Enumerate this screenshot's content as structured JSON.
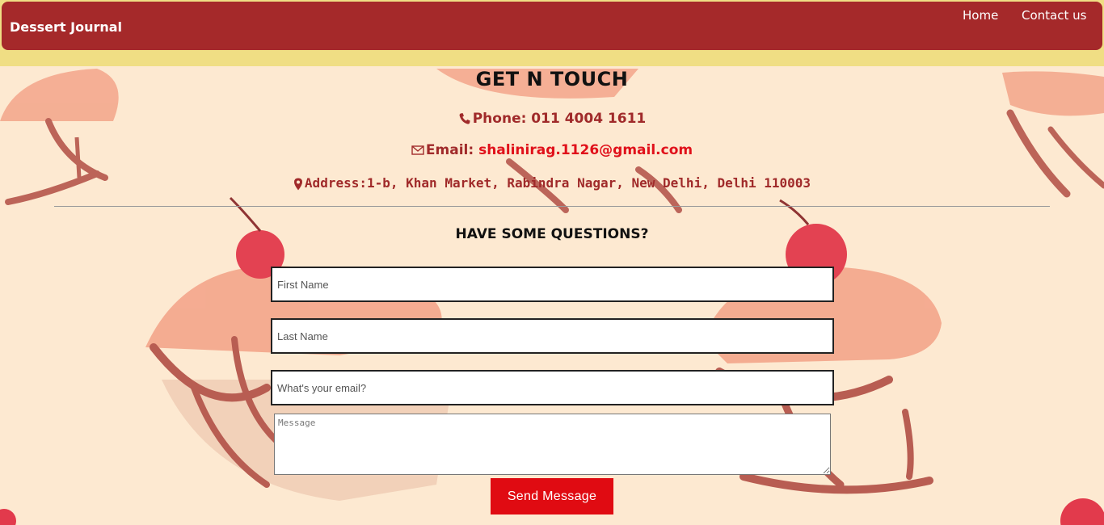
{
  "navbar": {
    "brand": "Dessert Journal",
    "links": [
      {
        "label": "Home"
      },
      {
        "label": "Contact us"
      }
    ]
  },
  "contact": {
    "title": "GET N TOUCH",
    "phone": "Phone: 011 4004 1611",
    "email_label": "Email: ",
    "email_value": "shalinirag.1126@gmail.com",
    "address": "Address:1-b, Khan Market, Rabindra Nagar, New Delhi, Delhi 110003"
  },
  "form": {
    "heading": "HAVE SOME QUESTIONS?",
    "first_name_placeholder": "First Name",
    "last_name_placeholder": "Last Name",
    "email_placeholder": "What's your email?",
    "message_placeholder": "Message",
    "submit_label": "Send Message"
  },
  "colors": {
    "navbar": "#a5292a",
    "band": "#f0de84",
    "background": "#fde9d1",
    "accent_red": "#e00b12",
    "text_maroon": "#a02a2a"
  }
}
